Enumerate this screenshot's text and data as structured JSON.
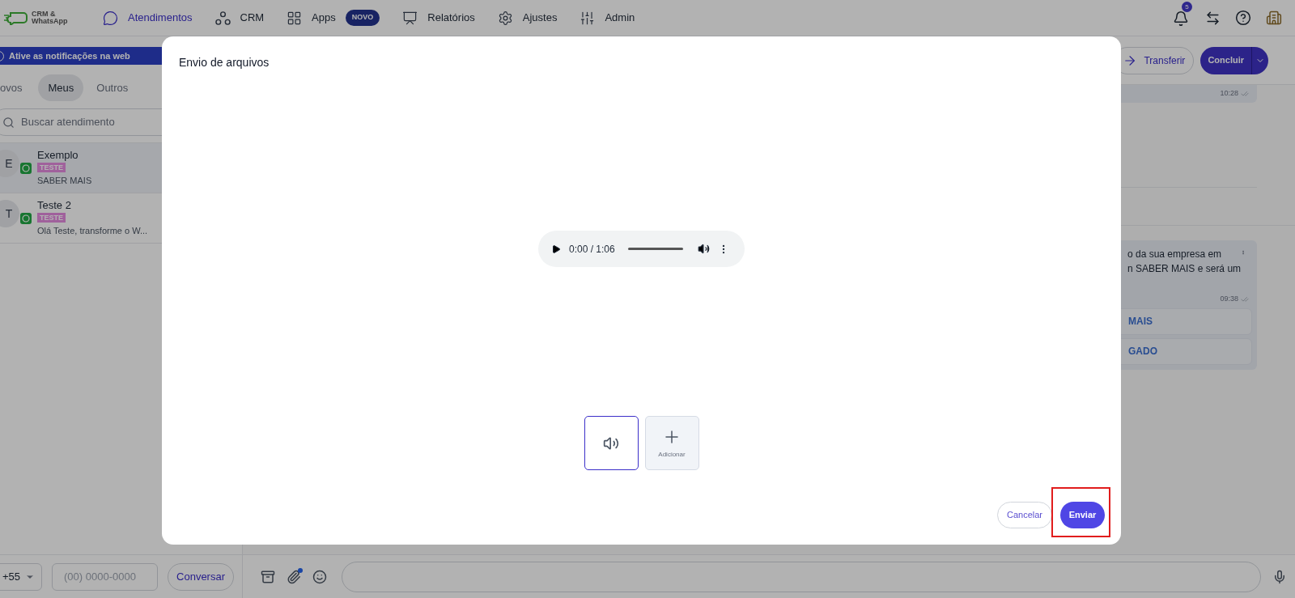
{
  "header": {
    "logo_lines": [
      "CRM &",
      "WhatsApp"
    ],
    "nav": [
      {
        "label": "Atendimentos",
        "selected": true
      },
      {
        "label": "CRM",
        "selected": false
      },
      {
        "label": "Apps",
        "selected": false,
        "badge": "NOVO"
      },
      {
        "label": "Relatórios",
        "selected": false
      },
      {
        "label": "Ajustes",
        "selected": false
      },
      {
        "label": "Admin",
        "selected": false
      }
    ],
    "notification_count": "5"
  },
  "sidebar": {
    "banner": "Ative as notificações na web",
    "tabs": [
      {
        "label": "ovos",
        "selected": false
      },
      {
        "label": "Meus",
        "selected": true
      },
      {
        "label": "Outros",
        "selected": false
      }
    ],
    "search": {
      "placeholder": "Buscar atendimento"
    },
    "conversations": [
      {
        "initial": "E",
        "name": "Exemplo",
        "tag": "TESTE",
        "preview": "SABER MAIS",
        "selected": true
      },
      {
        "initial": "T",
        "name": "Teste 2",
        "tag": "TESTE",
        "preview": "Olá Teste, transforme o W...",
        "selected": false
      }
    ],
    "footer": {
      "country_code": "+55",
      "phone_placeholder": "(00) 0000-0000",
      "button": "Conversar"
    }
  },
  "chat": {
    "transfer_button": "Transferir",
    "conclude_button": "Concluir",
    "messages": [
      {
        "kind": "tail",
        "time": "10:28"
      },
      {
        "kind": "text",
        "lines": [
          "o da sua empresa em",
          "n SABER MAIS e será um"
        ],
        "time": "09:38",
        "buttons": [
          "MAIS",
          "GADO"
        ]
      }
    ]
  },
  "modal": {
    "title": "Envio de arquivos",
    "player": {
      "time": "0:00 / 1:06",
      "level": 0
    },
    "thumbnails": [
      {
        "kind": "audio",
        "selected": true
      },
      {
        "kind": "add",
        "label": "Adicionar",
        "selected": false
      }
    ],
    "cancel_button": "Cancelar",
    "send_button": "Enviar",
    "send_highlighted": true
  }
}
